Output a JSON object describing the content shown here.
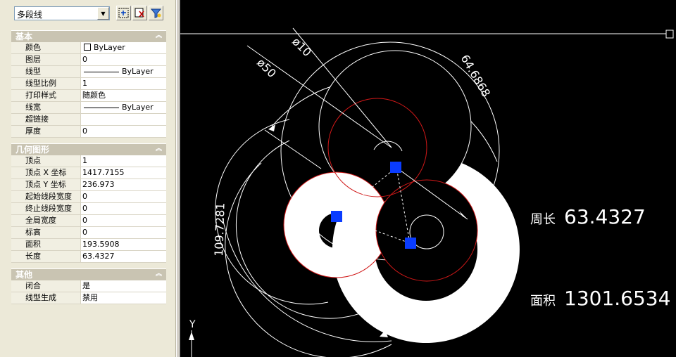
{
  "toolbar": {
    "object_type": "多段线",
    "select_icon": "quick-select-icon",
    "pick_icon": "pick-objects-icon",
    "filter_icon": "filter-icon"
  },
  "sections": [
    {
      "title": "基本",
      "rows": [
        {
          "label": "颜色",
          "value": "ByLayer",
          "swatch": true
        },
        {
          "label": "图层",
          "value": "0"
        },
        {
          "label": "线型",
          "value": "ByLayer",
          "line": true
        },
        {
          "label": "线型比例",
          "value": "1"
        },
        {
          "label": "打印样式",
          "value": "随颜色"
        },
        {
          "label": "线宽",
          "value": "ByLayer",
          "line": true
        },
        {
          "label": "超链接",
          "value": ""
        },
        {
          "label": "厚度",
          "value": "0"
        }
      ]
    },
    {
      "title": "几何图形",
      "rows": [
        {
          "label": "顶点",
          "value": "1"
        },
        {
          "label": "顶点 X 坐标",
          "value": "1417.7155"
        },
        {
          "label": "顶点 Y 坐标",
          "value": "236.973"
        },
        {
          "label": "起始线段宽度",
          "value": "0"
        },
        {
          "label": "终止线段宽度",
          "value": "0"
        },
        {
          "label": "全局宽度",
          "value": "0"
        },
        {
          "label": "标高",
          "value": "0"
        },
        {
          "label": "面积",
          "value": "193.5908"
        },
        {
          "label": "长度",
          "value": "63.4327"
        }
      ]
    },
    {
      "title": "其他",
      "rows": [
        {
          "label": "闭合",
          "value": "是"
        },
        {
          "label": "线型生成",
          "value": "禁用"
        }
      ]
    }
  ],
  "drawing": {
    "dim_d50": "ø50",
    "dim_d10": "ø10",
    "dim_arc1": "64.6868",
    "dim_arc2": "109.7281",
    "perimeter_label": "周长",
    "perimeter_value": "63.4327",
    "area_label": "面积",
    "area_value": "1301.6534",
    "axis_y": "Y",
    "grip_color": "#0a3cff",
    "red_color": "#d01818"
  }
}
